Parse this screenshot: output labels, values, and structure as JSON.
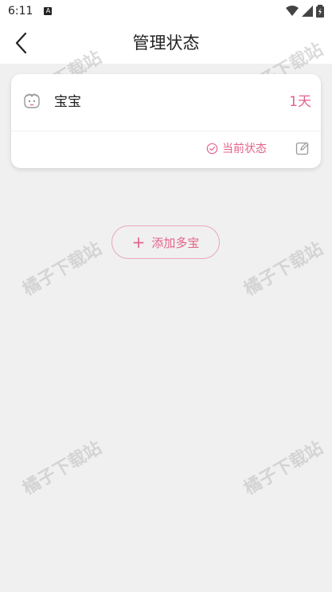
{
  "status_bar": {
    "time": "6:11",
    "notification_letter": "A"
  },
  "header": {
    "title": "管理状态"
  },
  "child": {
    "name": "宝宝",
    "days": "1天",
    "status_label": "当前状态"
  },
  "add_button": {
    "plus": "+",
    "label": "添加多宝"
  },
  "watermark": {
    "text": "橘子下载站"
  },
  "colors": {
    "accent": "#e5628a",
    "background": "#f0f0f0"
  }
}
